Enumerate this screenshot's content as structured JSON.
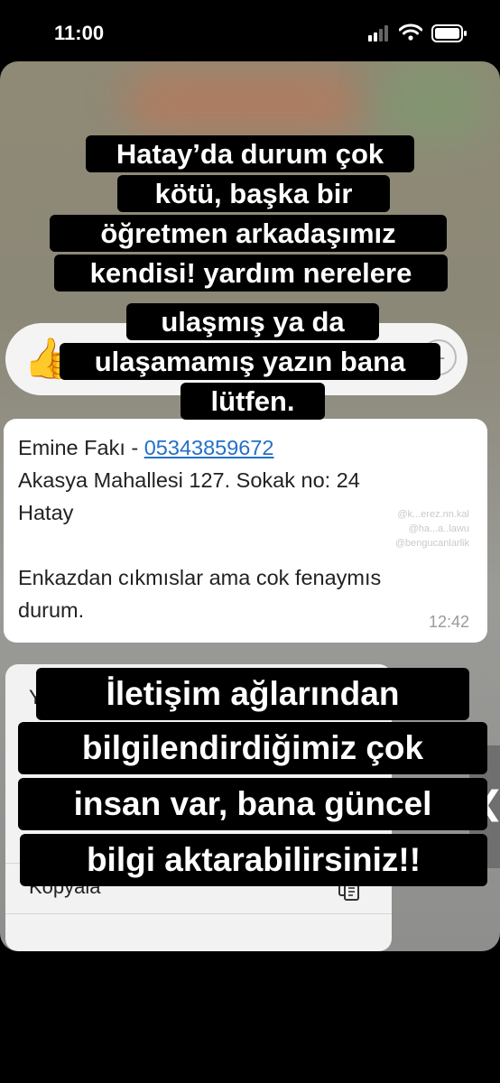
{
  "status_bar": {
    "time": "11:00"
  },
  "reaction_bar": {
    "emoji": "👍",
    "add": "+"
  },
  "message": {
    "sender": "Emine Fakı -",
    "phone": "05343859672",
    "address_line1": "Akasya Mahallesi 127. Sokak no: 24",
    "address_line2": "Hatay",
    "body_line1": "Enkazdan cıkmıslar ama cok fenaymıs",
    "body_line2": "durum.",
    "time": "12:42",
    "watermark": [
      "@k...erez.nn.kal",
      "@ha...a..lawu",
      "@bengucanlarlik"
    ]
  },
  "context_menu": {
    "first_item_partial": "Y",
    "copy_label": "Kopyala"
  },
  "caption_top": [
    "Hatay’da durum çok",
    "kötü, başka bir",
    "öğretmen arkadaşımız",
    "kendisi! yardım nerelere",
    "ulaşmış ya da",
    "ulaşamamış yazın bana",
    "lütfen."
  ],
  "caption_bottom": [
    "İletişim ağlarından",
    "bilgilendirdiğimiz çok",
    "insan var, bana güncel",
    "bilgi aktarabilirsiniz!!"
  ],
  "side_handle": {
    "glyph": "❮"
  }
}
